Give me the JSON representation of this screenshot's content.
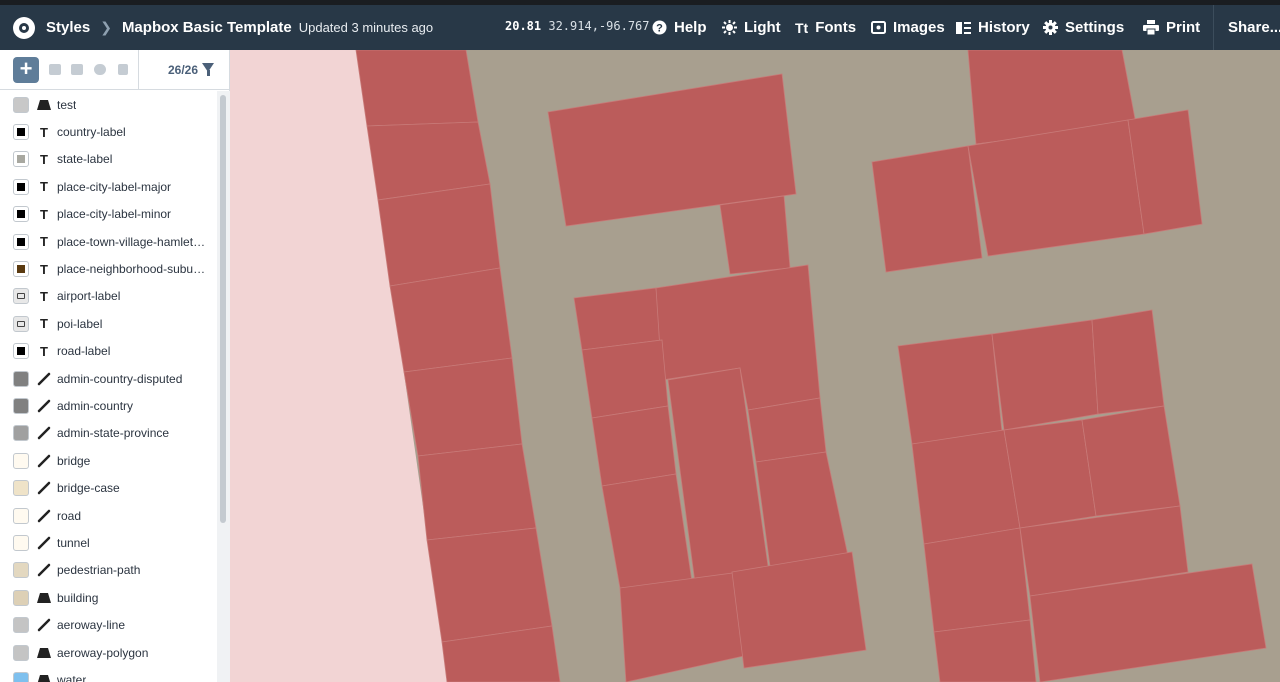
{
  "topbar": {
    "breadcrumb_root": "Styles",
    "style_name": "Mapbox Basic Template",
    "updated": "Updated 3 minutes ago",
    "zoom": "20.81",
    "lat_lng": "32.914,-96.767",
    "items": [
      {
        "label": "Help",
        "icon": "help-icon"
      },
      {
        "label": "Light",
        "icon": "sun-icon"
      },
      {
        "label": "Fonts",
        "icon": "fonts-icon"
      },
      {
        "label": "Images",
        "icon": "image-icon"
      },
      {
        "label": "History",
        "icon": "history-icon"
      },
      {
        "label": "Settings",
        "icon": "gear-icon"
      },
      {
        "label": "Print",
        "icon": "printer-icon"
      },
      {
        "label": "Share...",
        "icon": ""
      }
    ]
  },
  "sidebar": {
    "count": "26/26",
    "layers": [
      {
        "name": "test",
        "type": "fill",
        "color": "#c8c8c8"
      },
      {
        "name": "country-label",
        "type": "symbol",
        "color": "#000000"
      },
      {
        "name": "state-label",
        "type": "symbol",
        "color": "#a8a8a0"
      },
      {
        "name": "place-city-label-major",
        "type": "symbol",
        "color": "#000000"
      },
      {
        "name": "place-city-label-minor",
        "type": "symbol",
        "color": "#000000"
      },
      {
        "name": "place-town-village-hamlet-l...",
        "type": "symbol",
        "color": "#000000"
      },
      {
        "name": "place-neighborhood-suburb...",
        "type": "symbol",
        "color": "#5a3a10"
      },
      {
        "name": "airport-label",
        "type": "icon",
        "color": "#e8e8e8"
      },
      {
        "name": "poi-label",
        "type": "icon",
        "color": "#e8e8e8"
      },
      {
        "name": "road-label",
        "type": "symbol",
        "color": "#000000"
      },
      {
        "name": "admin-country-disputed",
        "type": "line",
        "color": "#808080"
      },
      {
        "name": "admin-country",
        "type": "line",
        "color": "#808080"
      },
      {
        "name": "admin-state-province",
        "type": "line",
        "color": "#a0a0a0"
      },
      {
        "name": "bridge",
        "type": "line",
        "color": "#fffaf0"
      },
      {
        "name": "bridge-case",
        "type": "line",
        "color": "#efe3c8"
      },
      {
        "name": "road",
        "type": "line",
        "color": "#fffaf0"
      },
      {
        "name": "tunnel",
        "type": "line",
        "color": "#fffaf0"
      },
      {
        "name": "pedestrian-path",
        "type": "line",
        "color": "#e3d8c0"
      },
      {
        "name": "building",
        "type": "fill",
        "color": "#ddd0b6"
      },
      {
        "name": "aeroway-line",
        "type": "line",
        "color": "#c4c4c4"
      },
      {
        "name": "aeroway-polygon",
        "type": "fill",
        "color": "#c4c4c4"
      },
      {
        "name": "water",
        "type": "fill",
        "color": "#7ec0ee"
      }
    ]
  },
  "map": {
    "background": "#a89f8f",
    "building_color": "#bb5c5b",
    "side_fill": "#f2d4d4"
  }
}
